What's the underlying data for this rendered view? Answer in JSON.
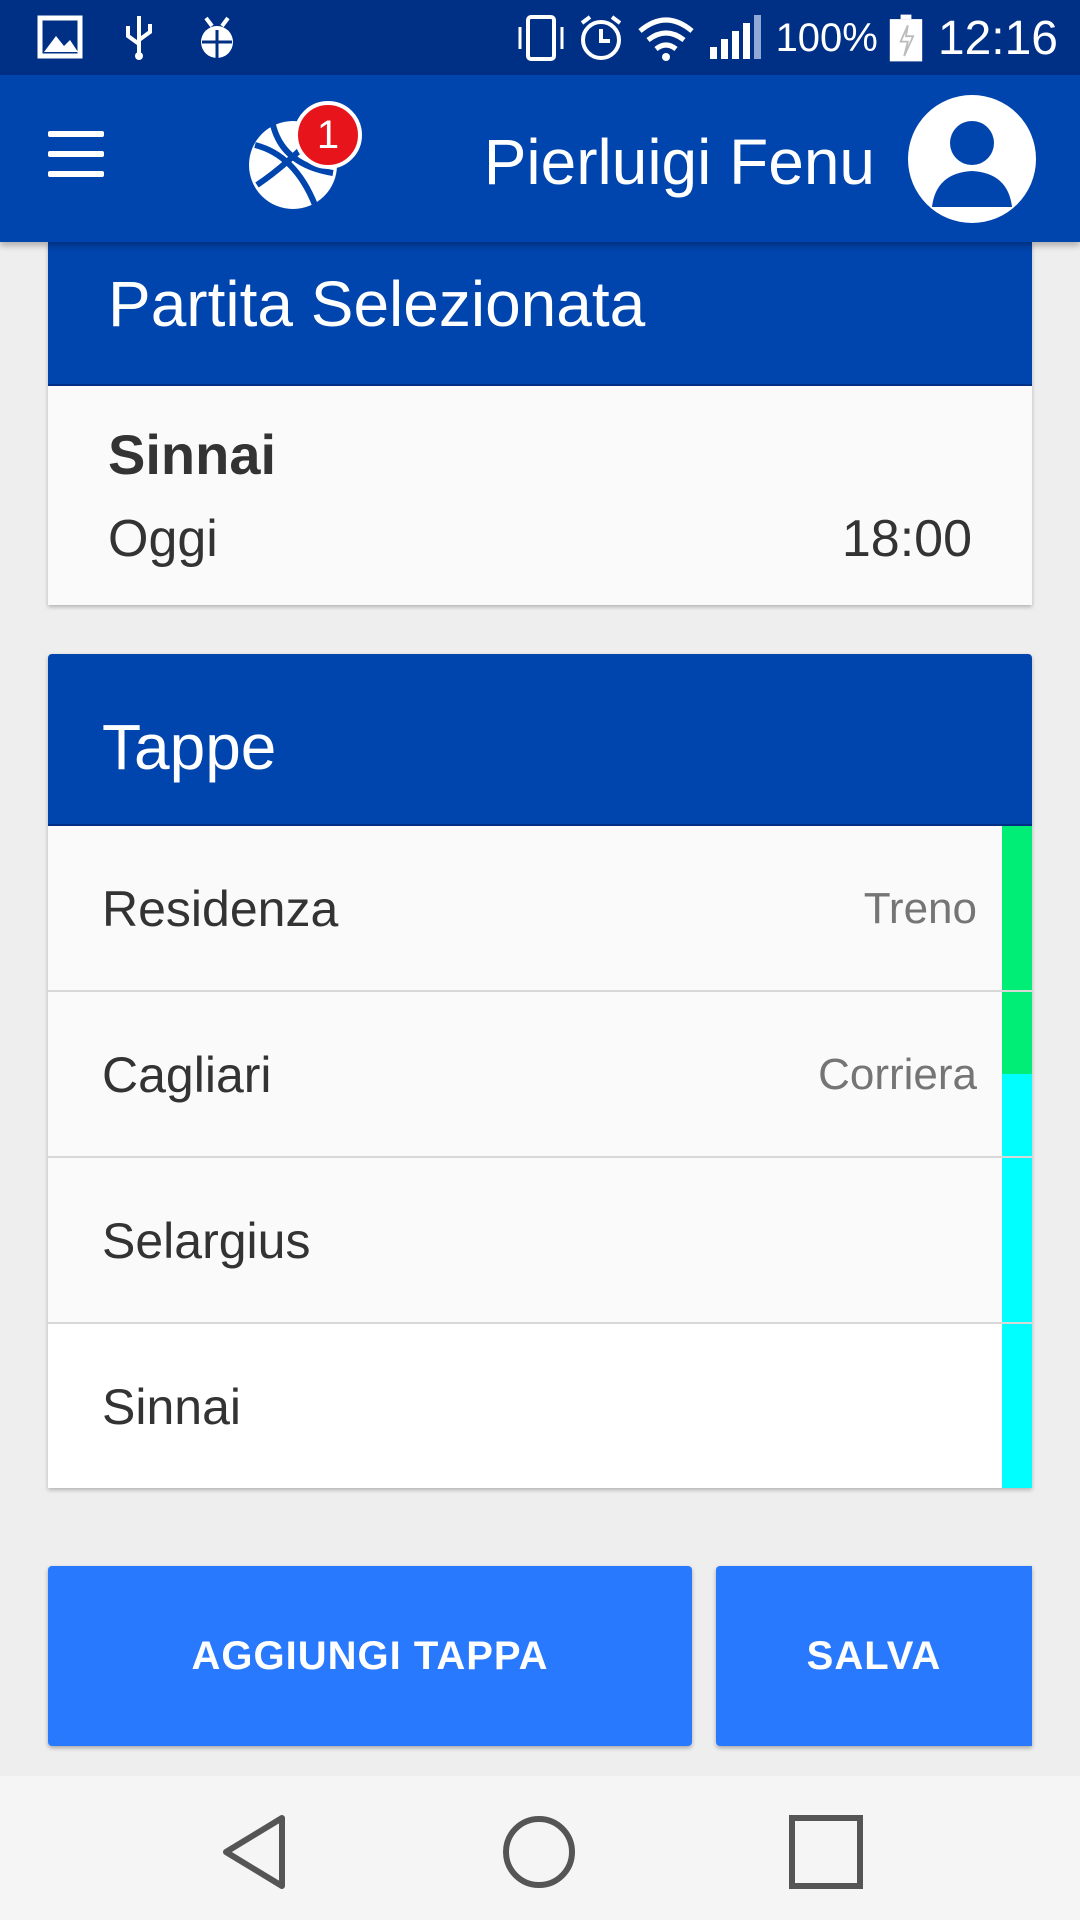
{
  "status_bar": {
    "battery_percent": "100%",
    "time": "12:16",
    "icons": [
      "image-icon",
      "usb-icon",
      "bug-icon",
      "vibrate-icon",
      "alarm-icon",
      "wifi-icon",
      "signal-icon",
      "battery-icon"
    ]
  },
  "app_bar": {
    "badge_count": "1",
    "user_name": "Pierluigi Fenu",
    "icons": [
      "menu-icon",
      "basketball-icon",
      "avatar-icon"
    ]
  },
  "selected_match": {
    "header": "Partita Selezionata",
    "name": "Sinnai",
    "day": "Oggi",
    "time": "18:00"
  },
  "stops": {
    "header": "Tappe",
    "items": [
      {
        "place": "Residenza",
        "transport": "Treno"
      },
      {
        "place": "Cagliari",
        "transport": "Corriera"
      },
      {
        "place": "Selargius",
        "transport": ""
      },
      {
        "place": "Sinnai",
        "transport": ""
      }
    ]
  },
  "actions": {
    "add_stop": "AGGIUNGI TAPPA",
    "save": "SALVA"
  },
  "colors": {
    "status_bar": "#002f86",
    "app_bar": "#0044ad",
    "button": "#2979ff",
    "badge": "#e8141c",
    "stripe_green": "#00ee76",
    "stripe_cyan": "#00ffff"
  }
}
